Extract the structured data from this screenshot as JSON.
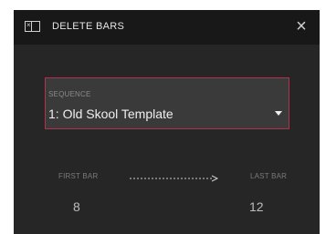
{
  "dialog": {
    "title": "DELETE BARS",
    "close_symbol": "×",
    "icon": "window-x-icon"
  },
  "sequence": {
    "label": "SEQUENCE",
    "value": "1: Old Skool Template",
    "caret_icon": "caret-down-icon",
    "accent_color": "#b2324d"
  },
  "bars": {
    "first_label": "FIRST BAR",
    "first_value": "8",
    "last_label": "LAST BAR",
    "last_value": "12",
    "arrow_icon": "dotted-arrow-right-icon"
  }
}
